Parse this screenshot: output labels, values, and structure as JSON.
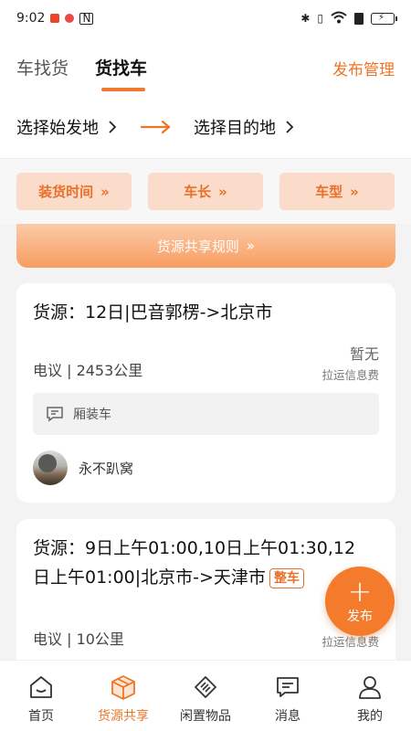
{
  "status_bar": {
    "time": "9:02"
  },
  "header": {
    "tabs": [
      {
        "label": "车找货",
        "active": false
      },
      {
        "label": "货找车",
        "active": true
      }
    ],
    "publish_manage": "发布管理"
  },
  "route": {
    "origin": "选择始发地",
    "destination": "选择目的地"
  },
  "filters": [
    {
      "label": "装货时间"
    },
    {
      "label": "车长"
    },
    {
      "label": "车型"
    }
  ],
  "share_rules": "货源共享规则",
  "cards": [
    {
      "title": "货源：12日|巴音郭楞->北京市",
      "meta": "电议 | 2453公里",
      "fee_value": "暂无",
      "fee_label": "拉运信息费",
      "vehicle": "厢装车",
      "user": "永不趴窝"
    },
    {
      "title_line1": "货源：9日上午01:00,10日上午01:30,12",
      "title_line2": "日上午01:00|北京市->天津市",
      "tag": "整车",
      "meta": "电议 | 10公里",
      "fee_label": "拉运信息费"
    }
  ],
  "fab": {
    "label": "发布"
  },
  "bottom_nav": [
    {
      "label": "首页",
      "icon": "home-icon",
      "active": false
    },
    {
      "label": "货源共享",
      "icon": "box-icon",
      "active": true
    },
    {
      "label": "闲置物品",
      "icon": "tag-icon",
      "active": false
    },
    {
      "label": "消息",
      "icon": "message-icon",
      "active": false
    },
    {
      "label": "我的",
      "icon": "person-icon",
      "active": false
    }
  ],
  "colors": {
    "accent": "#ee7426",
    "filter_bg": "#fbdcca"
  }
}
